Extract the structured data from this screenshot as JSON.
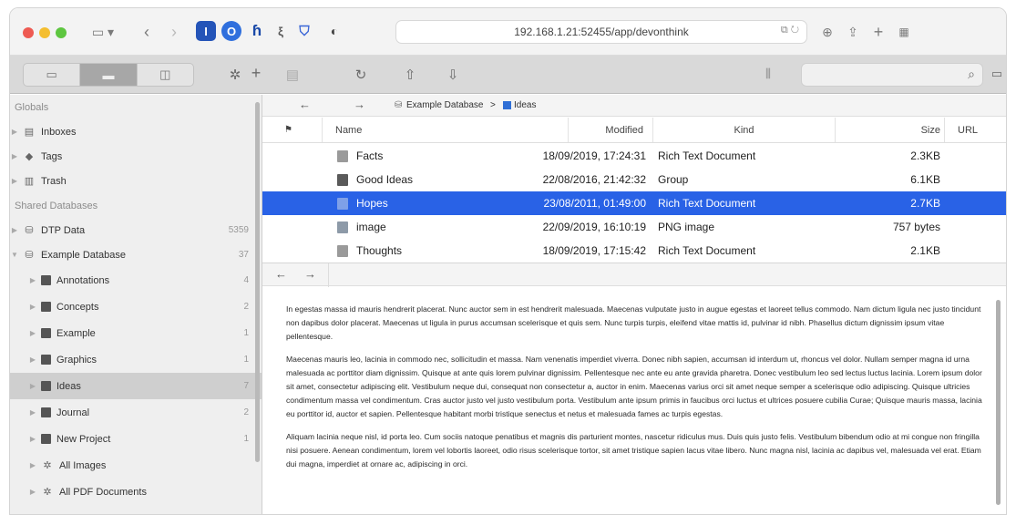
{
  "browser": {
    "url": "192.168.1.21:52455/app/devonthink",
    "ext_icons": [
      "sidebar-icon",
      "back-icon",
      "forward-icon",
      "ext-i-icon",
      "ext-o-icon",
      "ext-r-icon",
      "ext-s-icon",
      "shield-icon",
      "privacy-icon"
    ]
  },
  "toolbar": {
    "plus_label": "+"
  },
  "sidebar": {
    "sections": {
      "globals": "Globals",
      "shared": "Shared Databases"
    },
    "globals": [
      {
        "label": "Inboxes",
        "icon": "inbox-icon"
      },
      {
        "label": "Tags",
        "icon": "tag-icon"
      },
      {
        "label": "Trash",
        "icon": "trash-icon"
      }
    ],
    "databases": [
      {
        "label": "DTP Data",
        "count": "5359"
      },
      {
        "label": "Example Database",
        "count": "37"
      }
    ],
    "groups": [
      {
        "label": "Annotations",
        "count": "4"
      },
      {
        "label": "Concepts",
        "count": "2"
      },
      {
        "label": "Example",
        "count": "1"
      },
      {
        "label": "Graphics",
        "count": "1"
      },
      {
        "label": "Ideas",
        "count": "7"
      },
      {
        "label": "Journal",
        "count": "2"
      },
      {
        "label": "New Project",
        "count": "1"
      }
    ],
    "smart": [
      {
        "label": "All Images"
      },
      {
        "label": "All PDF Documents"
      }
    ]
  },
  "breadcrumb": {
    "db": "Example Database",
    "sep": ">",
    "group": "Ideas"
  },
  "table": {
    "headers": {
      "flag": "⚑",
      "name": "Name",
      "modified": "Modified",
      "kind": "Kind",
      "size": "Size",
      "url": "URL"
    },
    "rows": [
      {
        "name": "Facts",
        "modified": "18/09/2019, 17:24:31",
        "kind": "Rich Text Document",
        "size": "2.3KB",
        "icon": "rtf"
      },
      {
        "name": "Good Ideas",
        "modified": "22/08/2016, 21:42:32",
        "kind": "Group",
        "size": "6.1KB",
        "icon": "group"
      },
      {
        "name": "Hopes",
        "modified": "23/08/2011, 01:49:00",
        "kind": "Rich Text Document",
        "size": "2.7KB",
        "icon": "rtf"
      },
      {
        "name": "image",
        "modified": "22/09/2019, 16:10:19",
        "kind": "PNG image",
        "size": "757 bytes",
        "icon": "image"
      },
      {
        "name": "Thoughts",
        "modified": "18/09/2019, 17:15:42",
        "kind": "Rich Text Document",
        "size": "2.1KB",
        "icon": "rtf"
      }
    ],
    "selected_index": 2
  },
  "document": {
    "p1": "In egestas massa id mauris hendrerit placerat. Nunc auctor sem in est hendrerit malesuada. Maecenas vulputate justo in augue egestas et laoreet tellus commodo. Nam dictum ligula nec justo tincidunt non dapibus dolor placerat. Maecenas ut ligula in purus accumsan scelerisque et quis sem. Nunc turpis turpis, eleifend vitae mattis id, pulvinar id nibh. Phasellus dictum dignissim ipsum vitae pellentesque.",
    "p2": "Maecenas mauris leo, lacinia in commodo nec, sollicitudin et massa. Nam venenatis imperdiet viverra. Donec nibh sapien, accumsan id interdum ut, rhoncus vel dolor. Nullam semper magna id urna malesuada ac porttitor diam dignissim. Quisque at ante quis lorem pulvinar dignissim. Pellentesque nec ante eu ante gravida pharetra. Donec vestibulum leo sed lectus luctus lacinia. Lorem ipsum dolor sit amet, consectetur adipiscing elit. Vestibulum neque dui, consequat non consectetur a, auctor in enim. Maecenas varius orci sit amet neque semper a scelerisque odio adipiscing. Quisque ultricies condimentum massa vel condimentum. Cras auctor justo vel justo vestibulum porta. Vestibulum ante ipsum primis in faucibus orci luctus et ultrices posuere cubilia Curae; Quisque mauris massa, lacinia eu porttitor id, auctor et sapien. Pellentesque habitant morbi tristique senectus et netus et malesuada fames ac turpis egestas.",
    "p3": "Aliquam lacinia neque nisl, id porta leo. Cum sociis natoque penatibus et magnis dis parturient montes, nascetur ridiculus mus. Duis quis justo felis. Vestibulum bibendum odio at mi congue non fringilla nisi posuere. Aenean condimentum, lorem vel lobortis laoreet, odio risus scelerisque tortor, sit amet tristique sapien lacus vitae libero. Nunc magna nisl, lacinia ac dapibus vel, malesuada vel erat. Etiam dui magna, imperdiet at ornare ac, adipiscing in orci."
  }
}
